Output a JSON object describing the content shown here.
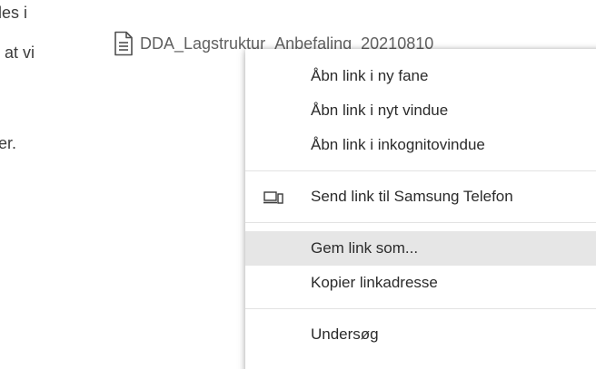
{
  "document": {
    "line1": "les i",
    "line2": "at vi",
    "line3": "er."
  },
  "attachment": {
    "icon": "document-icon",
    "filename": "DDA_Lagstruktur_Anbefaling_20210810"
  },
  "context_menu": {
    "group1": [
      {
        "label": "Åbn link i ny fane"
      },
      {
        "label": "Åbn link i nyt vindue"
      },
      {
        "label": "Åbn link i inkognitovindue"
      }
    ],
    "group2": [
      {
        "label": "Send link til Samsung Telefon",
        "icon": "devices-icon"
      }
    ],
    "group3": [
      {
        "label": "Gem link som...",
        "highlighted": true
      },
      {
        "label": "Kopier linkadresse"
      }
    ],
    "group4": [
      {
        "label": "Undersøg"
      }
    ]
  },
  "colors": {
    "menu_background": "#ffffff",
    "highlight": "#e6e6e6",
    "text": "#2b2b2b",
    "separator": "#e3e3e3"
  }
}
